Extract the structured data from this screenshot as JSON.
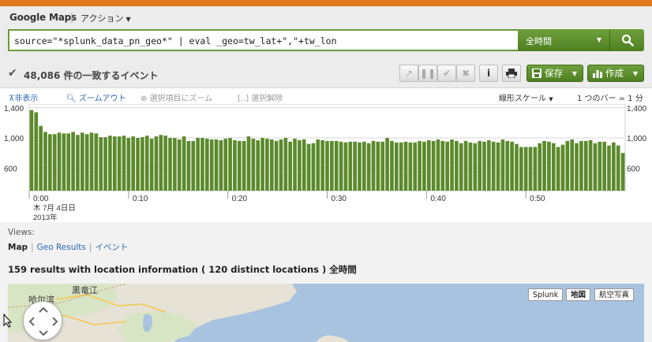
{
  "app": {
    "title": "Google Maps",
    "separator": "|",
    "action_menu": "アクション"
  },
  "search": {
    "query": "source=\"*splunk_data_pn_geo*\" | eval _geo=tw_lat+\",\"+tw_lon",
    "time_range": "全時間"
  },
  "results": {
    "count_label": "48,086 件の一致するイベント",
    "save_label": "保存",
    "create_label": "作成"
  },
  "timeline": {
    "hide": "非表示",
    "zoom_out": "ズームアウト",
    "zoom_selection": "選択項目にズーム",
    "deselect": "選択解除",
    "scale": "線形スケール",
    "bar_span": "1 つのバー = 1 分",
    "date_line1": "木 7月 4日日",
    "date_line2": "2013年"
  },
  "chart_data": {
    "type": "bar",
    "x": [
      "0:00",
      "0:01",
      "0:02",
      "0:03",
      "0:04",
      "0:05",
      "0:06",
      "0:07",
      "0:08",
      "0:09",
      "0:10",
      "0:11",
      "0:12",
      "0:13",
      "0:14",
      "0:15",
      "0:16",
      "0:17",
      "0:18",
      "0:19",
      "0:20",
      "0:21",
      "0:22",
      "0:23",
      "0:24",
      "0:25",
      "0:26",
      "0:27",
      "0:28",
      "0:29",
      "0:30",
      "0:31",
      "0:32",
      "0:33",
      "0:34",
      "0:35",
      "0:36",
      "0:37",
      "0:38",
      "0:39",
      "0:40",
      "0:41",
      "0:42",
      "0:43",
      "0:44",
      "0:45",
      "0:46",
      "0:47",
      "0:48",
      "0:49",
      "0:50",
      "0:51",
      "0:52",
      "0:53",
      "0:54",
      "0:55",
      "0:56",
      "0:57",
      "0:58",
      "0:59",
      "1:00"
    ],
    "values": [
      1370,
      1340,
      1160,
      1080,
      1050,
      1050,
      1070,
      1060,
      1060,
      1080,
      1040,
      1070,
      1050,
      1070,
      1060,
      1010,
      1010,
      1030,
      1020,
      1020,
      1030,
      1000,
      1020,
      1000,
      1010,
      1030,
      990,
      1020,
      1040,
      1030,
      1000,
      1000,
      980,
      1020,
      960,
      960,
      1000,
      1000,
      990,
      980,
      980,
      970,
      990,
      1000,
      970,
      960,
      960,
      1020,
      990,
      970,
      1000,
      990,
      980,
      960,
      980,
      1000,
      950,
      990,
      970,
      980,
      920,
      930,
      980,
      970,
      960,
      960,
      960,
      950,
      940,
      950,
      950,
      940,
      950,
      930,
      960,
      950,
      950,
      1000,
      960,
      940,
      940,
      950,
      940,
      940,
      960,
      950,
      970,
      960,
      980,
      960,
      950,
      980,
      960,
      930,
      960,
      940,
      930,
      960,
      950,
      970,
      950,
      940,
      980,
      960,
      950,
      920,
      880,
      880,
      880,
      880,
      930,
      960,
      950,
      930,
      880,
      910,
      960,
      980,
      930,
      960,
      960,
      970,
      930,
      950,
      950,
      900,
      940,
      900,
      800
    ],
    "x_ticks": [
      "0:00",
      "0:10",
      "0:20",
      "0:30",
      "0:40",
      "0:50"
    ],
    "y_ticks": [
      "1,400",
      "1,000",
      "600"
    ],
    "ylim": [
      300,
      1450
    ],
    "grid": true,
    "bar_color": "#5b8a2c"
  },
  "views": {
    "label": "Views:",
    "map": "Map",
    "geo_results": "Geo Results",
    "events": "イベント",
    "location_info": "159 results with location information ( 120 distinct locations ) 全時間"
  },
  "map": {
    "types": [
      "Splunk",
      "地図",
      "航空写真"
    ],
    "selected": "地図",
    "labels": [
      "黒竜江",
      "哈尔滨"
    ]
  },
  "colors": {
    "accent_orange": "#e07a1f",
    "green": "#5b8a2c",
    "link": "#2a68b0"
  }
}
